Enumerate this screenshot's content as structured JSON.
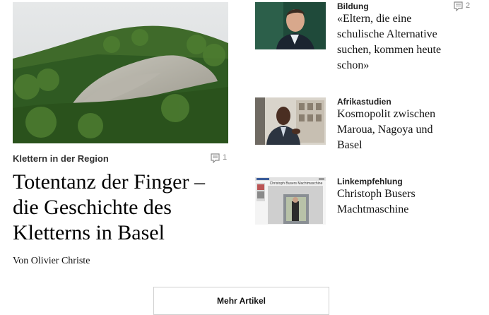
{
  "lead": {
    "kicker": "Klettern in der Region",
    "comment_count": "1",
    "title": "Totentanz der Finger – die Geschichte des Kletterns in Basel",
    "byline": "Von Olivier Christe"
  },
  "teasers": [
    {
      "kicker": "Bildung",
      "title": "«Eltern, die eine schulische Alternative suchen, kommen heute schon»",
      "comment_count": "2"
    },
    {
      "kicker": "Afrikastudien",
      "title": "Kosmopolit zwischen Maroua, Nagoya und Basel"
    },
    {
      "kicker": "Linkempfehlung",
      "title": "Christoph Busers Machtmaschine",
      "thumb_heading": "Christoph Busers Machtmaschine"
    }
  ],
  "more_button": {
    "label": "Mehr Artikel"
  },
  "icons": {
    "comment": "comment-bubble-icon"
  },
  "colors": {
    "comment_gray": "#8a8a8a",
    "text": "#111111"
  }
}
